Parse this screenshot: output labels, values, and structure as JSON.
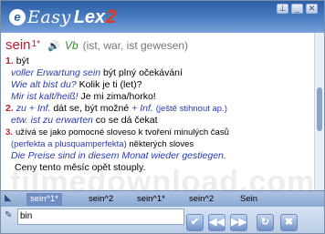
{
  "app": {
    "logo_prefix": "Easy",
    "logo_name": "Lex",
    "logo_version": "2"
  },
  "titlebar": {
    "buttons": [
      "pin",
      "minimize",
      "close"
    ]
  },
  "entry": {
    "headword": "sein",
    "superscript": "1*",
    "pos": "Vb",
    "forms": "(ist, war, ist gewesen)",
    "senses": [
      {
        "num": "1.",
        "cz": "být"
      },
      {
        "de": "voller Erwartung sein",
        "cz": "být plný očekávání"
      },
      {
        "de": "Wie alt bist du?",
        "cz": "Kolik je ti (let)?"
      },
      {
        "de": "Mir ist kalt/heiß!",
        "cz": "Je mi zima/horko!"
      },
      {
        "num": "2.",
        "de1": "zu + Inf.",
        "cz": "dát se, být možné",
        "de2": "+ Inf.",
        "note": "(ještě stihnout ap.)"
      },
      {
        "de": "etw. ist zu erwarten",
        "cz": "co se dá čekat"
      },
      {
        "num": "3.",
        "cz": "užívá se jako pomocné sloveso k tvoření minulých časů"
      },
      {
        "note": "(perfekta a plusquamperfekta)",
        "cz": "některých sloves"
      },
      {
        "de": "Die Preise sind in diesem Monat wieder gestiegen."
      },
      {
        "cz": "Ceny tento měsíc opět stouply."
      }
    ]
  },
  "tabs": [
    "sein^1*",
    "sein^2",
    "sein^1*",
    "sein^2",
    "Sein"
  ],
  "active_tab": 0,
  "search": {
    "value": "bin"
  },
  "toolbar_icons": [
    "checkmark-icon",
    "back-icon",
    "forward-icon",
    "refresh-icon",
    "tools-icon"
  ],
  "watermark": "filmedownload.com"
}
